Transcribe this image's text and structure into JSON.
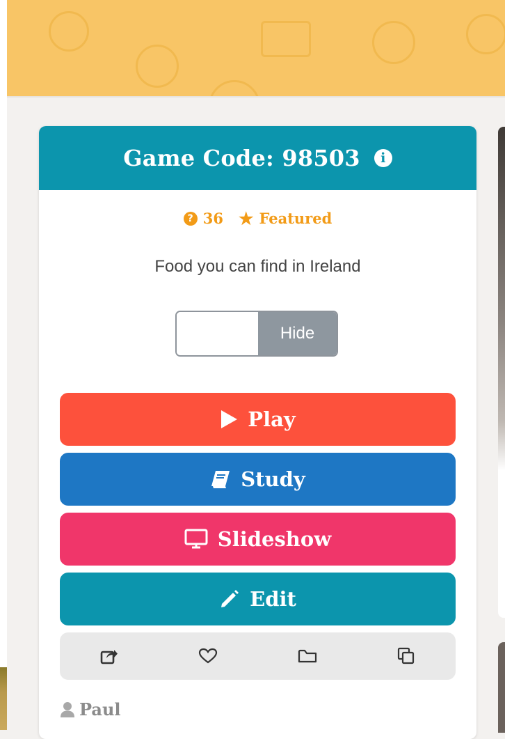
{
  "header": {},
  "card": {
    "title": "Game Code: 98503",
    "question_count": "36",
    "featured_label": "Featured",
    "description": "Food you can find in Ireland",
    "toggle": {
      "state_label": "Hide"
    },
    "buttons": {
      "play": "Play",
      "study": "Study",
      "slideshow": "Slideshow",
      "edit": "Edit"
    },
    "author": "Paul"
  },
  "colors": {
    "banner": "#f8c566",
    "card_header": "#0c95ad",
    "meta": "#f29b17",
    "play": "#fd513c",
    "study": "#1e77c4",
    "slideshow": "#f0366a",
    "edit": "#0c95ad",
    "toggle_off": "#8e979f"
  },
  "icons": {
    "info": "info-icon",
    "question": "question-circle-icon",
    "featured": "star-icon",
    "play": "play-icon",
    "study": "book-icon",
    "slideshow": "monitor-icon",
    "edit": "pencil-icon",
    "share": "share-icon",
    "favorite": "heart-icon",
    "folder": "folder-icon",
    "copy": "copy-icon",
    "author": "user-icon"
  }
}
